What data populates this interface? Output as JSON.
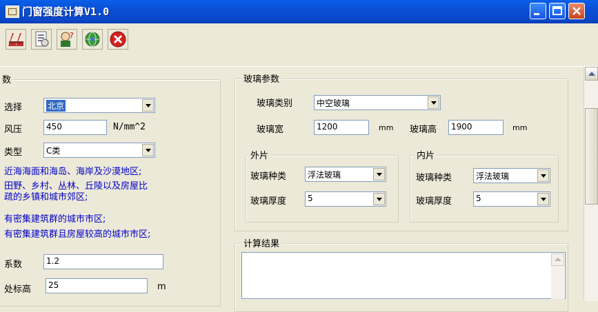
{
  "window": {
    "title": "门窗强度计算V1.0"
  },
  "toolbar": {
    "buttons": [
      "calc-icon",
      "document-icon",
      "help-person-icon",
      "globe-icon",
      "close-icon"
    ]
  },
  "left": {
    "section_title": "数",
    "region_label": "选择",
    "region_value": "北京",
    "wind_label": "风压",
    "wind_value": "450",
    "wind_unit": "N/mm^2",
    "type_label": "类型",
    "type_value": "C类",
    "desc1": "近海海面和海岛、海岸及沙漠地区;",
    "desc2a": "田野、乡村、丛林、丘陵以及房屋比",
    "desc2b": "疏的乡镇和城市郊区;",
    "desc3": "有密集建筑群的城市市区;",
    "desc4": "有密集建筑群且房屋较高的城市市区;",
    "coef_label": "系数",
    "coef_value": "1.2",
    "height_label": "处标高",
    "height_value": "25",
    "height_unit": "m"
  },
  "glass": {
    "title": "玻璃参数",
    "type_label": "玻璃类别",
    "type_value": "中空玻璃",
    "width_label": "玻璃宽",
    "width_value": "1200",
    "width_unit": "mm",
    "height_label": "玻璃高",
    "height_value": "1900",
    "height_unit": "mm",
    "outer": {
      "title": "外片",
      "kind_label": "玻璃种类",
      "kind_value": "浮法玻璃",
      "thick_label": "玻璃厚度",
      "thick_value": "5"
    },
    "inner": {
      "title": "内片",
      "kind_label": "玻璃种类",
      "kind_value": "浮法玻璃",
      "thick_label": "玻璃厚度",
      "thick_value": "5"
    }
  },
  "result": {
    "title": "计算结果"
  },
  "colors": {
    "titlebar": "#0a4fd6",
    "desc_text": "#0000c8",
    "selection": "#316ac5"
  }
}
